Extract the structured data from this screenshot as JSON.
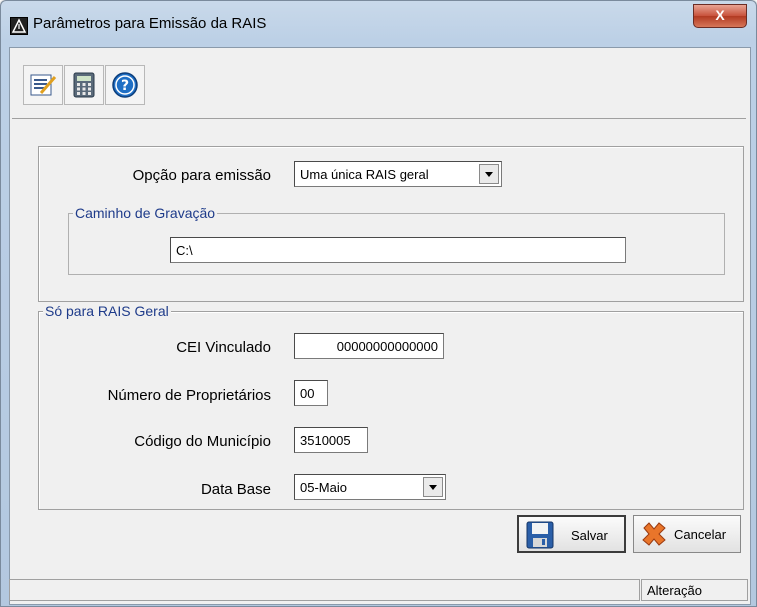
{
  "window": {
    "title": "Parâmetros para Emissão da RAIS",
    "close_glyph": "X"
  },
  "toolbar": {
    "buttons": [
      {
        "icon": "edit-form-icon"
      },
      {
        "icon": "calculator-icon"
      },
      {
        "icon": "help-icon",
        "glyph": "?"
      }
    ]
  },
  "section_emissao": {
    "opcao_label": "Opção para emissão",
    "opcao_value": "Uma única RAIS geral",
    "caminho_legend": "Caminho de Gravação",
    "caminho_value": "C:\\"
  },
  "section_rais_geral": {
    "legend": "Só para RAIS Geral",
    "cei_label": "CEI Vinculado",
    "cei_value": "00000000000000",
    "proprietarios_label": "Número de Proprietários",
    "proprietarios_value": "00",
    "municipio_label": "Código do Município",
    "municipio_value": "3510005",
    "data_base_label": "Data Base",
    "data_base_value": "05-Maio"
  },
  "actions": {
    "save_label": "Salvar",
    "cancel_label": "Cancelar"
  },
  "status": {
    "left": "",
    "mode": "Alteração"
  },
  "colors": {
    "legend_text": "#1e3b8a",
    "title_bar": "#c9d9ea",
    "close_button": "#c7513b"
  }
}
